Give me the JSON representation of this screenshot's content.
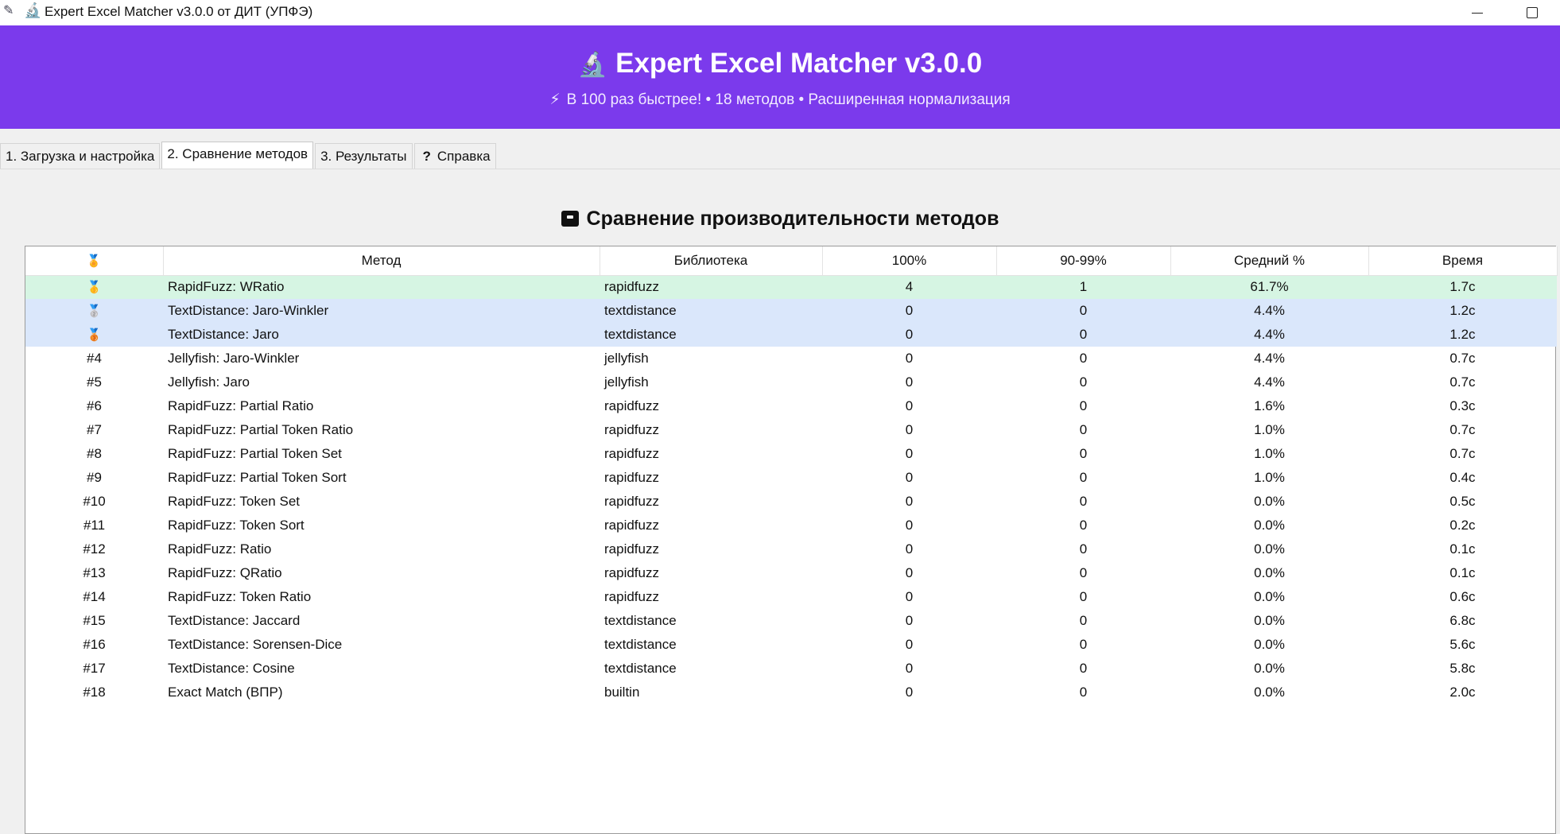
{
  "window": {
    "title": "Expert Excel Matcher v3.0.0 от ДИТ (УПФЭ)",
    "feather_icon": "feather-icon",
    "app_icon": "microscope-icon"
  },
  "header": {
    "icon": "🔬",
    "title": "Expert Excel Matcher v3.0.0",
    "subtitle": "В 100 раз быстрее! • 18 методов • Расширенная нормализация",
    "bolt_icon": "⚡",
    "background_color": "#7b3aec"
  },
  "tabs": [
    {
      "label": "1. Загрузка и настройка",
      "active": false
    },
    {
      "label": "2. Сравнение методов",
      "active": true
    },
    {
      "label": "3. Результаты",
      "active": false
    },
    {
      "label": "Справка",
      "active": false,
      "icon": "?"
    }
  ],
  "section": {
    "title": "Сравнение производительности методов",
    "icon": "box-icon"
  },
  "table": {
    "columns": [
      "🏅",
      "Метод",
      "Библиотека",
      "100%",
      "90-99%",
      "Средний %",
      "Время"
    ],
    "rows": [
      {
        "rank": "🥇",
        "method": "RapidFuzz: WRatio",
        "library": "rapidfuzz",
        "p100": "4",
        "p90": "1",
        "avg": "61.7%",
        "time": "1.7с",
        "highlight": "gold"
      },
      {
        "rank": "🥈",
        "method": "TextDistance: Jaro-Winkler",
        "library": "textdistance",
        "p100": "0",
        "p90": "0",
        "avg": "4.4%",
        "time": "1.2с",
        "highlight": "silver"
      },
      {
        "rank": "🥉",
        "method": "TextDistance: Jaro",
        "library": "textdistance",
        "p100": "0",
        "p90": "0",
        "avg": "4.4%",
        "time": "1.2с",
        "highlight": "bronze"
      },
      {
        "rank": "#4",
        "method": "Jellyfish: Jaro-Winkler",
        "library": "jellyfish",
        "p100": "0",
        "p90": "0",
        "avg": "4.4%",
        "time": "0.7с",
        "highlight": ""
      },
      {
        "rank": "#5",
        "method": "Jellyfish: Jaro",
        "library": "jellyfish",
        "p100": "0",
        "p90": "0",
        "avg": "4.4%",
        "time": "0.7с",
        "highlight": ""
      },
      {
        "rank": "#6",
        "method": "RapidFuzz: Partial Ratio",
        "library": "rapidfuzz",
        "p100": "0",
        "p90": "0",
        "avg": "1.6%",
        "time": "0.3с",
        "highlight": ""
      },
      {
        "rank": "#7",
        "method": "RapidFuzz: Partial Token Ratio",
        "library": "rapidfuzz",
        "p100": "0",
        "p90": "0",
        "avg": "1.0%",
        "time": "0.7с",
        "highlight": ""
      },
      {
        "rank": "#8",
        "method": "RapidFuzz: Partial Token Set",
        "library": "rapidfuzz",
        "p100": "0",
        "p90": "0",
        "avg": "1.0%",
        "time": "0.7с",
        "highlight": ""
      },
      {
        "rank": "#9",
        "method": "RapidFuzz: Partial Token Sort",
        "library": "rapidfuzz",
        "p100": "0",
        "p90": "0",
        "avg": "1.0%",
        "time": "0.4с",
        "highlight": ""
      },
      {
        "rank": "#10",
        "method": "RapidFuzz: Token Set",
        "library": "rapidfuzz",
        "p100": "0",
        "p90": "0",
        "avg": "0.0%",
        "time": "0.5с",
        "highlight": ""
      },
      {
        "rank": "#11",
        "method": "RapidFuzz: Token Sort",
        "library": "rapidfuzz",
        "p100": "0",
        "p90": "0",
        "avg": "0.0%",
        "time": "0.2с",
        "highlight": ""
      },
      {
        "rank": "#12",
        "method": "RapidFuzz: Ratio",
        "library": "rapidfuzz",
        "p100": "0",
        "p90": "0",
        "avg": "0.0%",
        "time": "0.1с",
        "highlight": ""
      },
      {
        "rank": "#13",
        "method": "RapidFuzz: QRatio",
        "library": "rapidfuzz",
        "p100": "0",
        "p90": "0",
        "avg": "0.0%",
        "time": "0.1с",
        "highlight": ""
      },
      {
        "rank": "#14",
        "method": "RapidFuzz: Token Ratio",
        "library": "rapidfuzz",
        "p100": "0",
        "p90": "0",
        "avg": "0.0%",
        "time": "0.6с",
        "highlight": ""
      },
      {
        "rank": "#15",
        "method": "TextDistance: Jaccard",
        "library": "textdistance",
        "p100": "0",
        "p90": "0",
        "avg": "0.0%",
        "time": "6.8с",
        "highlight": ""
      },
      {
        "rank": "#16",
        "method": "TextDistance: Sorensen-Dice",
        "library": "textdistance",
        "p100": "0",
        "p90": "0",
        "avg": "0.0%",
        "time": "5.6с",
        "highlight": ""
      },
      {
        "rank": "#17",
        "method": "TextDistance: Cosine",
        "library": "textdistance",
        "p100": "0",
        "p90": "0",
        "avg": "0.0%",
        "time": "5.8с",
        "highlight": ""
      },
      {
        "rank": "#18",
        "method": "Exact Match (ВПР)",
        "library": "builtin",
        "p100": "0",
        "p90": "0",
        "avg": "0.0%",
        "time": "2.0с",
        "highlight": ""
      }
    ],
    "highlight_colors": {
      "gold": "#d6f5e3",
      "silver": "#dae7fb",
      "bronze": "#dae7fb"
    }
  }
}
